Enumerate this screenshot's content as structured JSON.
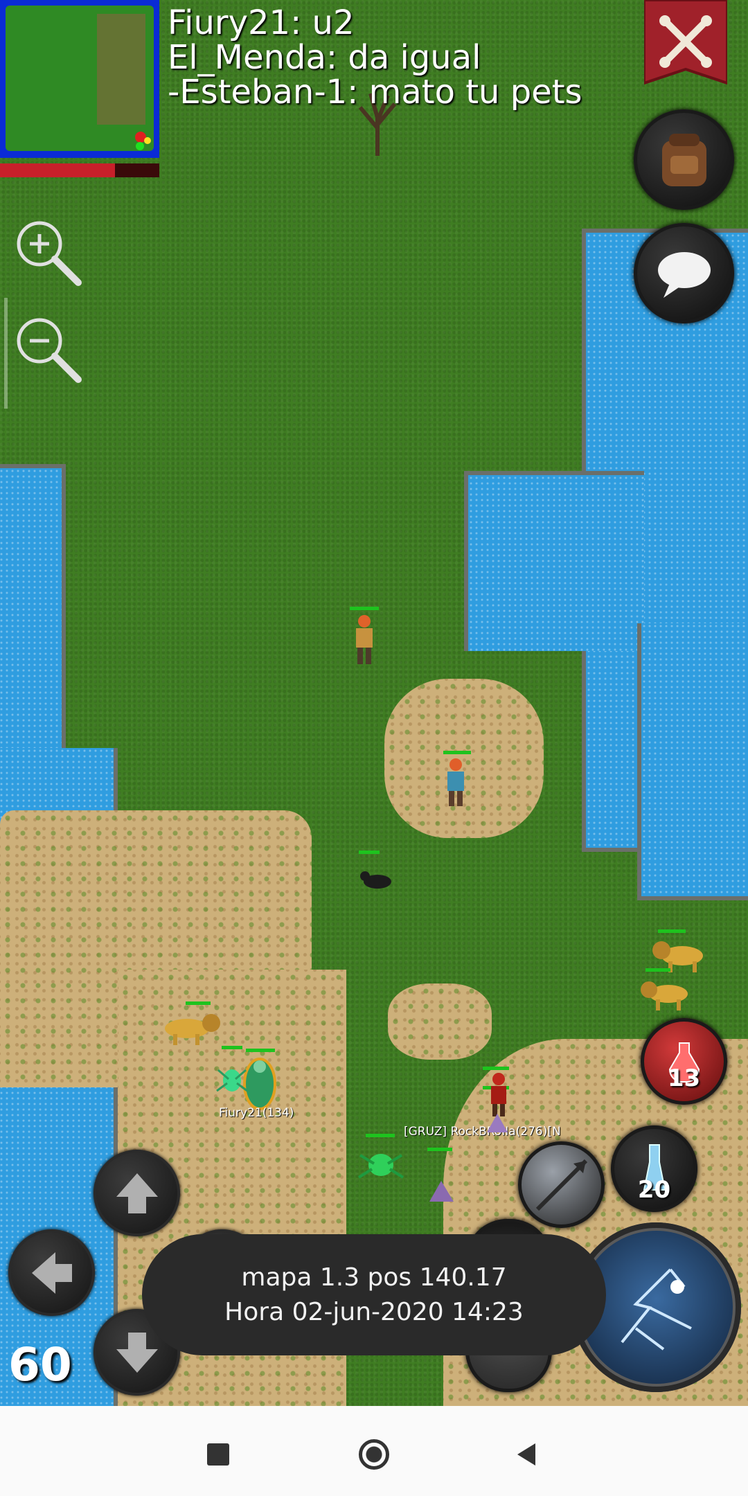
{
  "chat": {
    "lines": [
      "Fiury21: u2",
      "El_Menda: da igual",
      " -Esteban-1: mato tu pets"
    ]
  },
  "player_labels": {
    "self": "Fiury21(134)",
    "other": "[GRUZ] RockBRoIIa(276)[N"
  },
  "info_toast": {
    "line1": "mapa 1.3 pos 140.17",
    "line2": "Hora 02-jun-2020 14:23"
  },
  "fps": "60",
  "hotbar": {
    "red_potion_count": "13",
    "blue_potion_count": "20"
  },
  "icons": {
    "menu": "crossed-bones-banner-icon",
    "inventory": "backpack-icon",
    "chat": "speech-bubble-icon",
    "zoom_in": "zoom-in-icon",
    "zoom_out": "zoom-out-icon",
    "arrow_up": "arrow-up-icon",
    "arrow_left": "arrow-left-icon",
    "arrow_down": "arrow-down-icon",
    "spell": "lightning-spell-icon",
    "nav_square": "square-icon",
    "nav_home": "circle-icon",
    "nav_back": "triangle-back-icon"
  },
  "colors": {
    "grass": "#3f7d22",
    "water": "#2f9de0",
    "sand": "#cdb07a",
    "hp": "#1ec31e",
    "mana_bar": "#c8202a",
    "banner": "#a0212a"
  },
  "minimap": {
    "health_fraction": 0.72
  }
}
